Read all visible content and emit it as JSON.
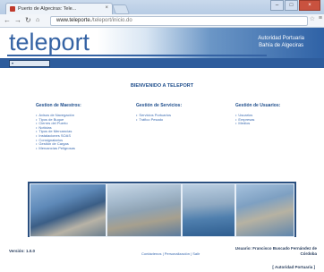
{
  "browser": {
    "tab_title": "Puerto de Algeciras: Tele...",
    "url_prefix": "www.teleporte.",
    "url_rest": "/teleport/inicio.do"
  },
  "header": {
    "logo_text": "teleport",
    "entity_line1": "Autoridad Portuaria",
    "entity_line2": "Bahía de Algeciras"
  },
  "welcome": "BIENVENIDO A TELEPORT",
  "sections": [
    {
      "title": "Gestion de Maestros:",
      "items": [
        "Avisos de Navegación",
        "Tipos de Buque",
        "Cierres del Puerto",
        "Noticias",
        "Tipos de Mercancías",
        "Instalaciones SOAS",
        "Consignatarios",
        "Gestión de Cargas",
        "Mercancías Peligrosas"
      ]
    },
    {
      "title": "Gestión de Servicios:",
      "items": [
        "Servicios Portuarios",
        "Tráfico Pesado"
      ]
    },
    {
      "title": "Gestión de Usuarios:",
      "items": [
        "Usuarios",
        "Empresas",
        "Medios"
      ]
    }
  ],
  "footer": {
    "version": "Versión: 1.0.0",
    "links": "Contáctenos | Personalización | Salir",
    "user_line1": "Usuario: Francisco Buscado Fernández de",
    "user_line2": "Córdoba",
    "role": "[ Autoridad Portuaria ]"
  },
  "colors": {
    "brand_blue": "#2d5c9c",
    "link_blue": "#3b6bb0"
  }
}
